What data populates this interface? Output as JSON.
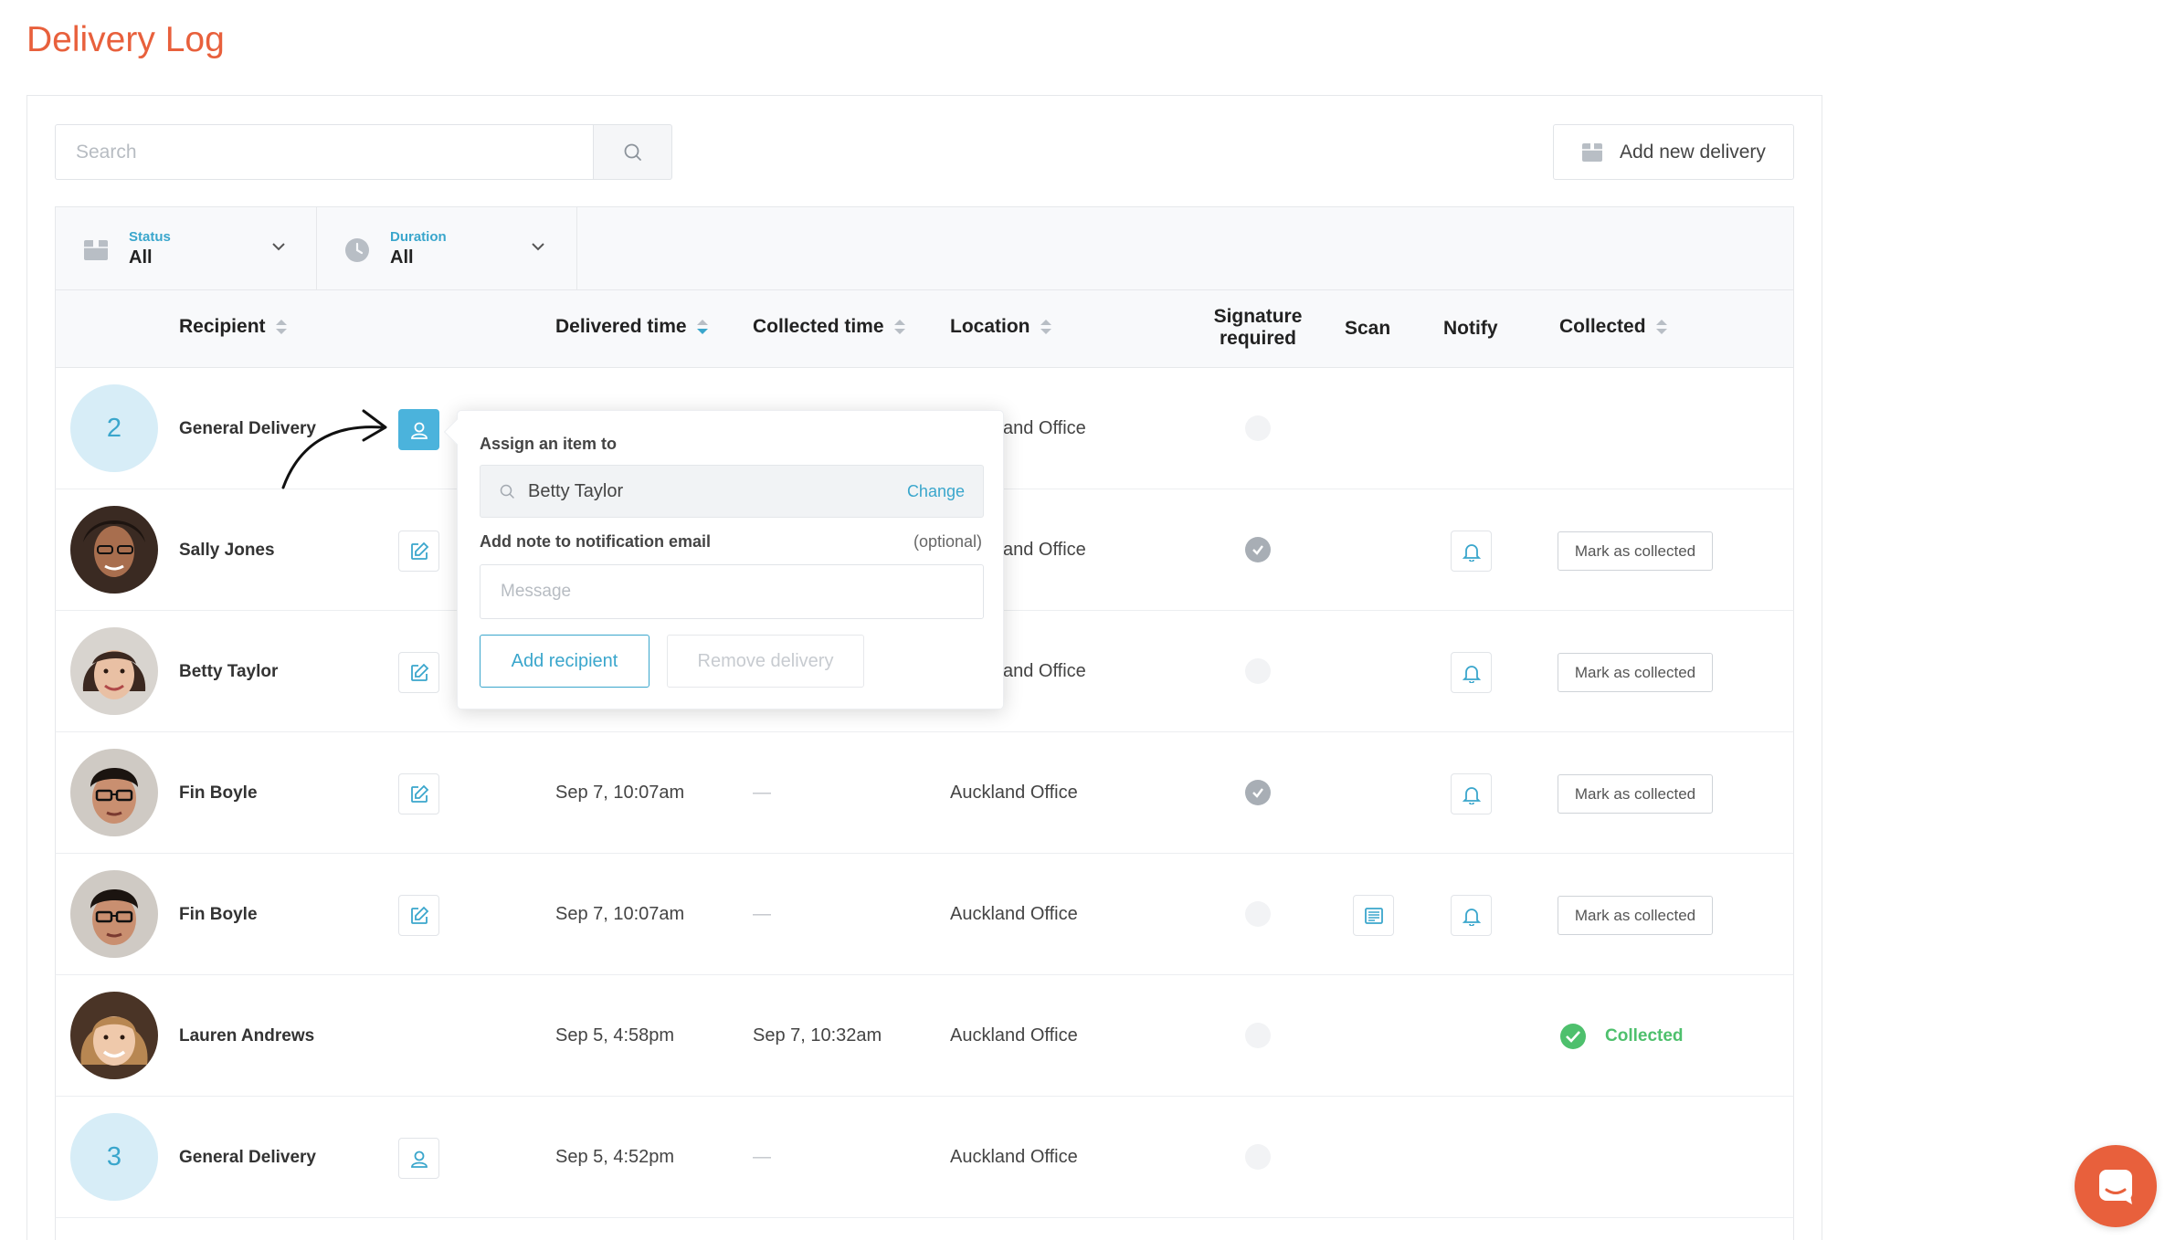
{
  "page": {
    "title": "Delivery Log"
  },
  "toolbar": {
    "search_placeholder": "Search",
    "add_delivery_label": "Add new delivery"
  },
  "filters": [
    {
      "label": "Status",
      "value": "All",
      "icon": "box-icon"
    },
    {
      "label": "Duration",
      "value": "All",
      "icon": "clock-icon"
    }
  ],
  "columns": {
    "recipient": "Recipient",
    "delivered": "Delivered time",
    "collected_time": "Collected time",
    "location": "Location",
    "signature_line1": "Signature",
    "signature_line2": "required",
    "scan": "Scan",
    "notify": "Notify",
    "collected": "Collected"
  },
  "rows": [
    {
      "name": "General Delivery",
      "avatar_number": "2",
      "delivered": "",
      "collected_time": "",
      "location": "Auckland Office",
      "location_visible": "and Office",
      "signature": false,
      "scan": false,
      "notify": false,
      "status": "none"
    },
    {
      "name": "Sally Jones",
      "delivered": "",
      "collected_time": "",
      "location": "Auckland Office",
      "location_visible": "and Office",
      "signature": true,
      "scan": false,
      "notify": true,
      "status": "mark"
    },
    {
      "name": "Betty Taylor",
      "delivered": "",
      "collected_time": "",
      "location": "Auckland Office",
      "location_visible": "and Office",
      "signature": false,
      "scan": false,
      "notify": true,
      "status": "mark"
    },
    {
      "name": "Fin Boyle",
      "delivered": "Sep 7, 10:07am",
      "collected_time": "—",
      "location": "Auckland Office",
      "signature": true,
      "scan": false,
      "notify": true,
      "status": "mark"
    },
    {
      "name": "Fin Boyle",
      "delivered": "Sep 7, 10:07am",
      "collected_time": "—",
      "location": "Auckland Office",
      "signature": false,
      "scan": true,
      "notify": true,
      "status": "mark"
    },
    {
      "name": "Lauren Andrews",
      "delivered": "Sep 5, 4:58pm",
      "collected_time": "Sep 7, 10:32am",
      "location": "Auckland Office",
      "signature": false,
      "scan": false,
      "notify": false,
      "status": "collected"
    },
    {
      "name": "General Delivery",
      "avatar_number": "3",
      "delivered": "Sep 5, 4:52pm",
      "collected_time": "—",
      "location": "Auckland Office",
      "signature": false,
      "scan": false,
      "notify": false,
      "status": "none"
    }
  ],
  "actions": {
    "mark_collected_label": "Mark as collected",
    "collected_label": "Collected"
  },
  "popover": {
    "assign_label": "Assign an item to",
    "assignee": "Betty Taylor",
    "change_label": "Change",
    "note_label": "Add note to notification email",
    "note_optional": "(optional)",
    "message_placeholder": "Message",
    "add_recipient_label": "Add recipient",
    "remove_delivery_label": "Remove delivery"
  },
  "colors": {
    "brand": "#e8603c",
    "accent": "#3aa6cc",
    "success": "#4ec06d"
  }
}
